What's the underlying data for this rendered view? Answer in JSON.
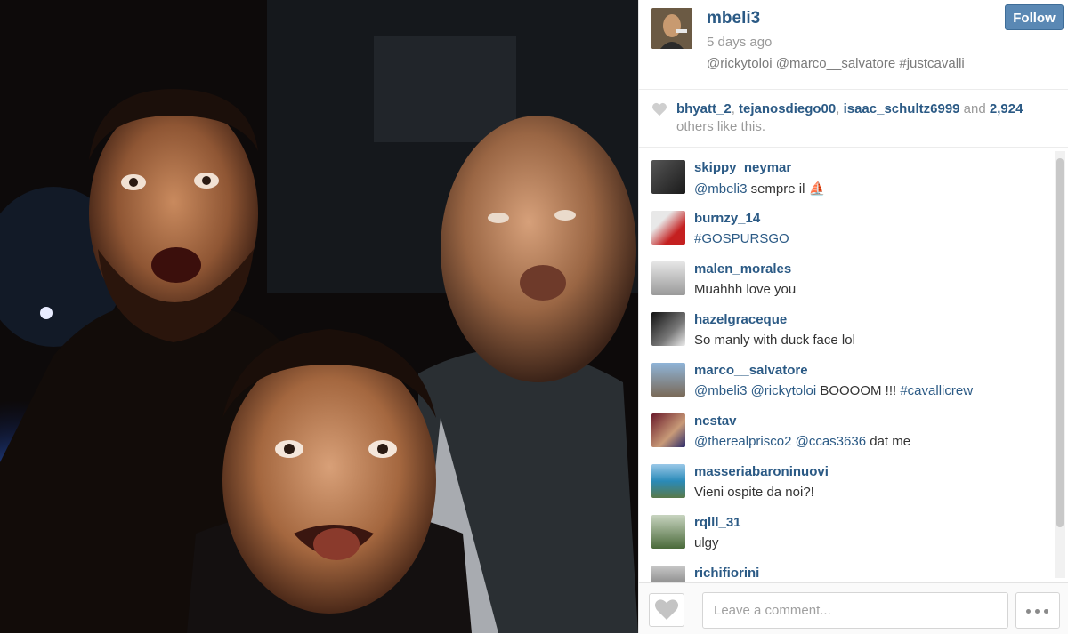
{
  "post": {
    "username": "mbeli3",
    "time": "5 days ago",
    "caption": {
      "mention1": "@rickytoloi",
      "mention2": "@marco__salvatore",
      "hashtag": "#justcavalli"
    },
    "follow_label": "Follow"
  },
  "likes": {
    "users": [
      "bhyatt_2",
      "tejanosdiego00",
      "isaac_schultz6999"
    ],
    "and_text": "and",
    "count": "2,924",
    "suffix": "others like this."
  },
  "comments": [
    {
      "user": "skippy_neymar",
      "text_a": "@mbeli3",
      "text_b": " sempre il ⛵"
    },
    {
      "user": "burnzy_14",
      "text_a": "#GOSPURSGO",
      "text_b": ""
    },
    {
      "user": "malen_morales",
      "text_a": "",
      "text_b": "Muahhh love you"
    },
    {
      "user": "hazelgraceque",
      "text_a": "",
      "text_b": "So manly with duck face lol"
    },
    {
      "user": "marco__salvatore",
      "text_a": "@mbeli3 @rickytoloi",
      "text_b": " BOOOOM !!! ",
      "text_c": "#cavallicrew"
    },
    {
      "user": "ncstav",
      "text_a": "@therealprisco2 @ccas3636",
      "text_b": " dat me"
    },
    {
      "user": "masseriabaroninuovi",
      "text_a": "",
      "text_b": "Vieni ospite da noi?!"
    },
    {
      "user": "rqlll_31",
      "text_a": "",
      "text_b": "ulgy"
    },
    {
      "user": "richifiorini",
      "text_a": "",
      "text_b": ""
    }
  ],
  "footer": {
    "comment_placeholder": "Leave a comment..."
  },
  "icons": {
    "heart": "heart-icon",
    "more": "more-dots-icon"
  },
  "colors": {
    "link": "#2b5a85",
    "follow_bg": "#5a88b4"
  }
}
